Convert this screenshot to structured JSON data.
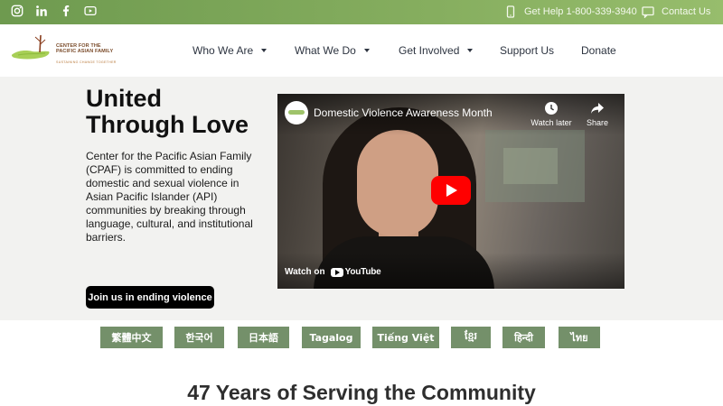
{
  "topbar": {
    "social": [
      "instagram-icon",
      "linkedin-icon",
      "facebook-icon",
      "youtube-icon"
    ],
    "help_text": "Get Help 1-800-339-3940",
    "contact_text": "Contact Us"
  },
  "header": {
    "logo": {
      "line1": "CENTER FOR THE",
      "line2": "PACIFIC ASIAN FAMILY",
      "tagline": "SUSTAINING CHANGE TOGETHER"
    },
    "nav": [
      {
        "label": "Who We Are",
        "has_dropdown": true
      },
      {
        "label": "What We Do",
        "has_dropdown": true
      },
      {
        "label": "Get Involved",
        "has_dropdown": true
      },
      {
        "label": "Support Us",
        "has_dropdown": false
      },
      {
        "label": "Donate",
        "has_dropdown": false
      }
    ]
  },
  "hero": {
    "title_line1": "United",
    "title_line2": "Through Love",
    "body": "Center for the Pacific Asian Family (CPAF) is committed to ending domestic and sexual violence in Asian Pacific Islander (API) communities by breaking through language, cultural, and institutional barriers.",
    "cta_label": "Join us in ending violence"
  },
  "video": {
    "title": "Domestic Violence Awareness Month",
    "watch_later": "Watch later",
    "share": "Share",
    "watch_on": "Watch on",
    "youtube_word": "YouTube"
  },
  "languages": [
    "繁體中文",
    "한국어",
    "日本語",
    "Tagalog",
    "Tiếng Việt",
    "ខ្មែរ",
    "हिन्दी",
    "ไทย"
  ],
  "section": {
    "title": "47 Years of Serving the Community"
  },
  "colors": {
    "topbar_green": "#86ae5f",
    "language_button": "#74906a",
    "cta_black": "#000000",
    "hero_bg": "#f2f2f0",
    "youtube_red": "#ff0000"
  }
}
